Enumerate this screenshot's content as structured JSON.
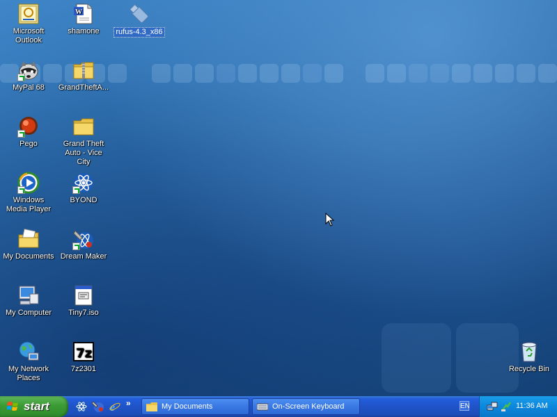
{
  "desktop": {
    "icons": [
      {
        "id": "outlook",
        "label": "Microsoft Outlook",
        "icon": "outlook-icon",
        "shortcut": false
      },
      {
        "id": "shamone",
        "label": "shamone",
        "icon": "word-document-icon",
        "shortcut": false
      },
      {
        "id": "rufus",
        "label": "rufus-4.3_x86",
        "icon": "usb-drive-icon",
        "shortcut": false,
        "selected": true
      },
      {
        "id": "mypal",
        "label": "MyPal 68",
        "icon": "raccoon-browser-icon",
        "shortcut": false
      },
      {
        "id": "gta-zip",
        "label": "GrandTheftA...",
        "icon": "zip-folder-icon",
        "shortcut": false
      },
      {
        "id": "pego",
        "label": "Pego",
        "icon": "red-ball-icon",
        "shortcut": true
      },
      {
        "id": "gta-folder",
        "label": "Grand Theft Auto - Vice City",
        "icon": "folder-icon",
        "shortcut": false
      },
      {
        "id": "wmp",
        "label": "Windows Media Player",
        "icon": "media-player-icon",
        "shortcut": true
      },
      {
        "id": "byond",
        "label": "BYOND",
        "icon": "byond-atom-icon",
        "shortcut": true
      },
      {
        "id": "mydocs",
        "label": "My Documents",
        "icon": "my-documents-icon",
        "shortcut": false
      },
      {
        "id": "dreammaker",
        "label": "Dream Maker",
        "icon": "dream-maker-icon",
        "shortcut": true
      },
      {
        "id": "mycomputer",
        "label": "My Computer",
        "icon": "computer-icon",
        "shortcut": false
      },
      {
        "id": "tiny7",
        "label": "Tiny7.iso",
        "icon": "iso-file-icon",
        "shortcut": false
      },
      {
        "id": "network",
        "label": "My Network Places",
        "icon": "network-icon",
        "shortcut": false
      },
      {
        "id": "7z",
        "label": "7z2301",
        "icon": "7zip-icon",
        "shortcut": false
      },
      {
        "id": "recycle",
        "label": "Recycle Bin",
        "icon": "recycle-bin-icon",
        "shortcut": false
      }
    ]
  },
  "taskbar": {
    "start_label": "start",
    "quick_launch": [
      "byond-icon",
      "dream-maker-icon",
      "internet-explorer-icon"
    ],
    "overflow": "»",
    "buttons": [
      {
        "label": "My Documents",
        "icon": "folder-icon"
      },
      {
        "label": "On-Screen Keyboard",
        "icon": "keyboard-icon"
      }
    ],
    "language": "EN",
    "tray_icons": [
      "network-connection-icon",
      "safely-remove-icon"
    ],
    "clock": "11:36 AM"
  },
  "colors": {
    "desktop_blue": "#2a6aaa",
    "taskbar_blue": "#245edc",
    "start_green": "#3c9b35",
    "selection_blue": "#316ac5"
  }
}
